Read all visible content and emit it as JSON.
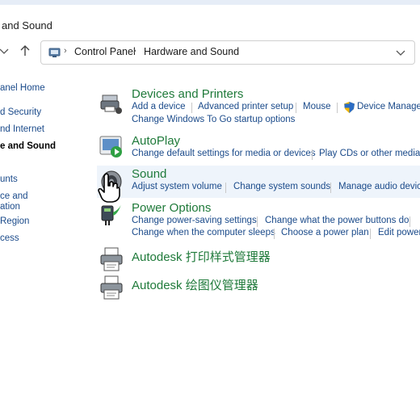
{
  "window": {
    "title": "and Sound"
  },
  "address_bar": {
    "breadcrumbs": [
      "Control Panel",
      "Hardware and Sound"
    ]
  },
  "sidebar": {
    "items": [
      {
        "label": "anel Home",
        "current": false
      },
      {
        "label": "d Security",
        "current": false
      },
      {
        "label": "nd Internet",
        "current": false
      },
      {
        "label": "e and Sound",
        "current": true
      },
      {
        "label": "unts",
        "current": false
      },
      {
        "label": "ce and",
        "current": false
      },
      {
        "label": "ation",
        "current": false
      },
      {
        "label": " Region",
        "current": false
      },
      {
        "label": "cess",
        "current": false
      }
    ]
  },
  "categories": [
    {
      "title": "Devices and Printers",
      "icon": "devices-printers-icon",
      "rows": [
        [
          "Add a device",
          "Advanced printer setup",
          "Mouse",
          "Device Manager"
        ],
        [
          "Change Windows To Go startup options"
        ]
      ]
    },
    {
      "title": "AutoPlay",
      "icon": "autoplay-icon",
      "rows": [
        [
          "Change default settings for media or devices",
          "Play CDs or other media a"
        ]
      ]
    },
    {
      "title": "Sound",
      "icon": "speaker-icon",
      "rows": [
        [
          "Adjust system volume",
          "Change system sounds",
          "Manage audio device"
        ]
      ]
    },
    {
      "title": "Power Options",
      "icon": "power-options-icon",
      "rows": [
        [
          "Change power-saving settings",
          "Change what the power buttons do"
        ],
        [
          "Change when the computer sleeps",
          "Choose a power plan",
          "Edit power"
        ]
      ]
    },
    {
      "title": "Autodesk 打印样式管理器",
      "icon": "printer-style-manager-icon",
      "rows": []
    },
    {
      "title": "Autodesk 绘图仪管理器",
      "icon": "plotter-manager-icon",
      "rows": []
    }
  ],
  "colors": {
    "category_title": "#1f7a3a",
    "link": "#1a4a8a",
    "hover_background": "#eef4fb"
  }
}
